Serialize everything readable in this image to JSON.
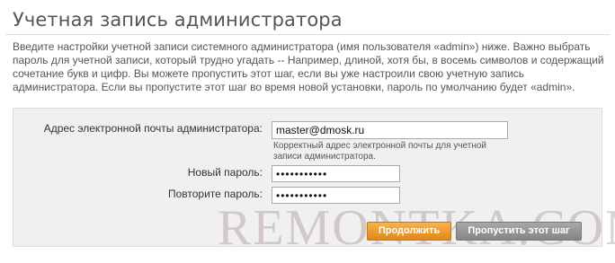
{
  "page": {
    "title": "Учетная запись администратора",
    "intro": "Введите настройки учетной записи системного администратора (имя пользователя «admin») ниже.        Важно выбрать пароль для учетной записи, который трудно угадать -- Например, длиной, хотя бы, в восемь символов и содержащий сочетание букв и цифр. Вы можете пропустить этот шаг, если вы уже настроили свою учетную запись администратора. Если вы пропустите этот шаг во время новой установки, пароль по умолчанию будет «admin»."
  },
  "form": {
    "email_label": "Адрес электронной почты администратора:",
    "email_value": "master@dmosk.ru",
    "email_help": "Корректный адрес электронной почты для учетной записи администратора.",
    "password_label": "Новый пароль:",
    "password_value": "•••••••••••",
    "confirm_label": "Повторите пароль:",
    "confirm_value": "•••••••••••"
  },
  "buttons": {
    "continue_label": "Продолжить",
    "skip_label": "Пропустить этот шаг"
  },
  "watermark": {
    "text": "REMONTKA.COM"
  }
}
